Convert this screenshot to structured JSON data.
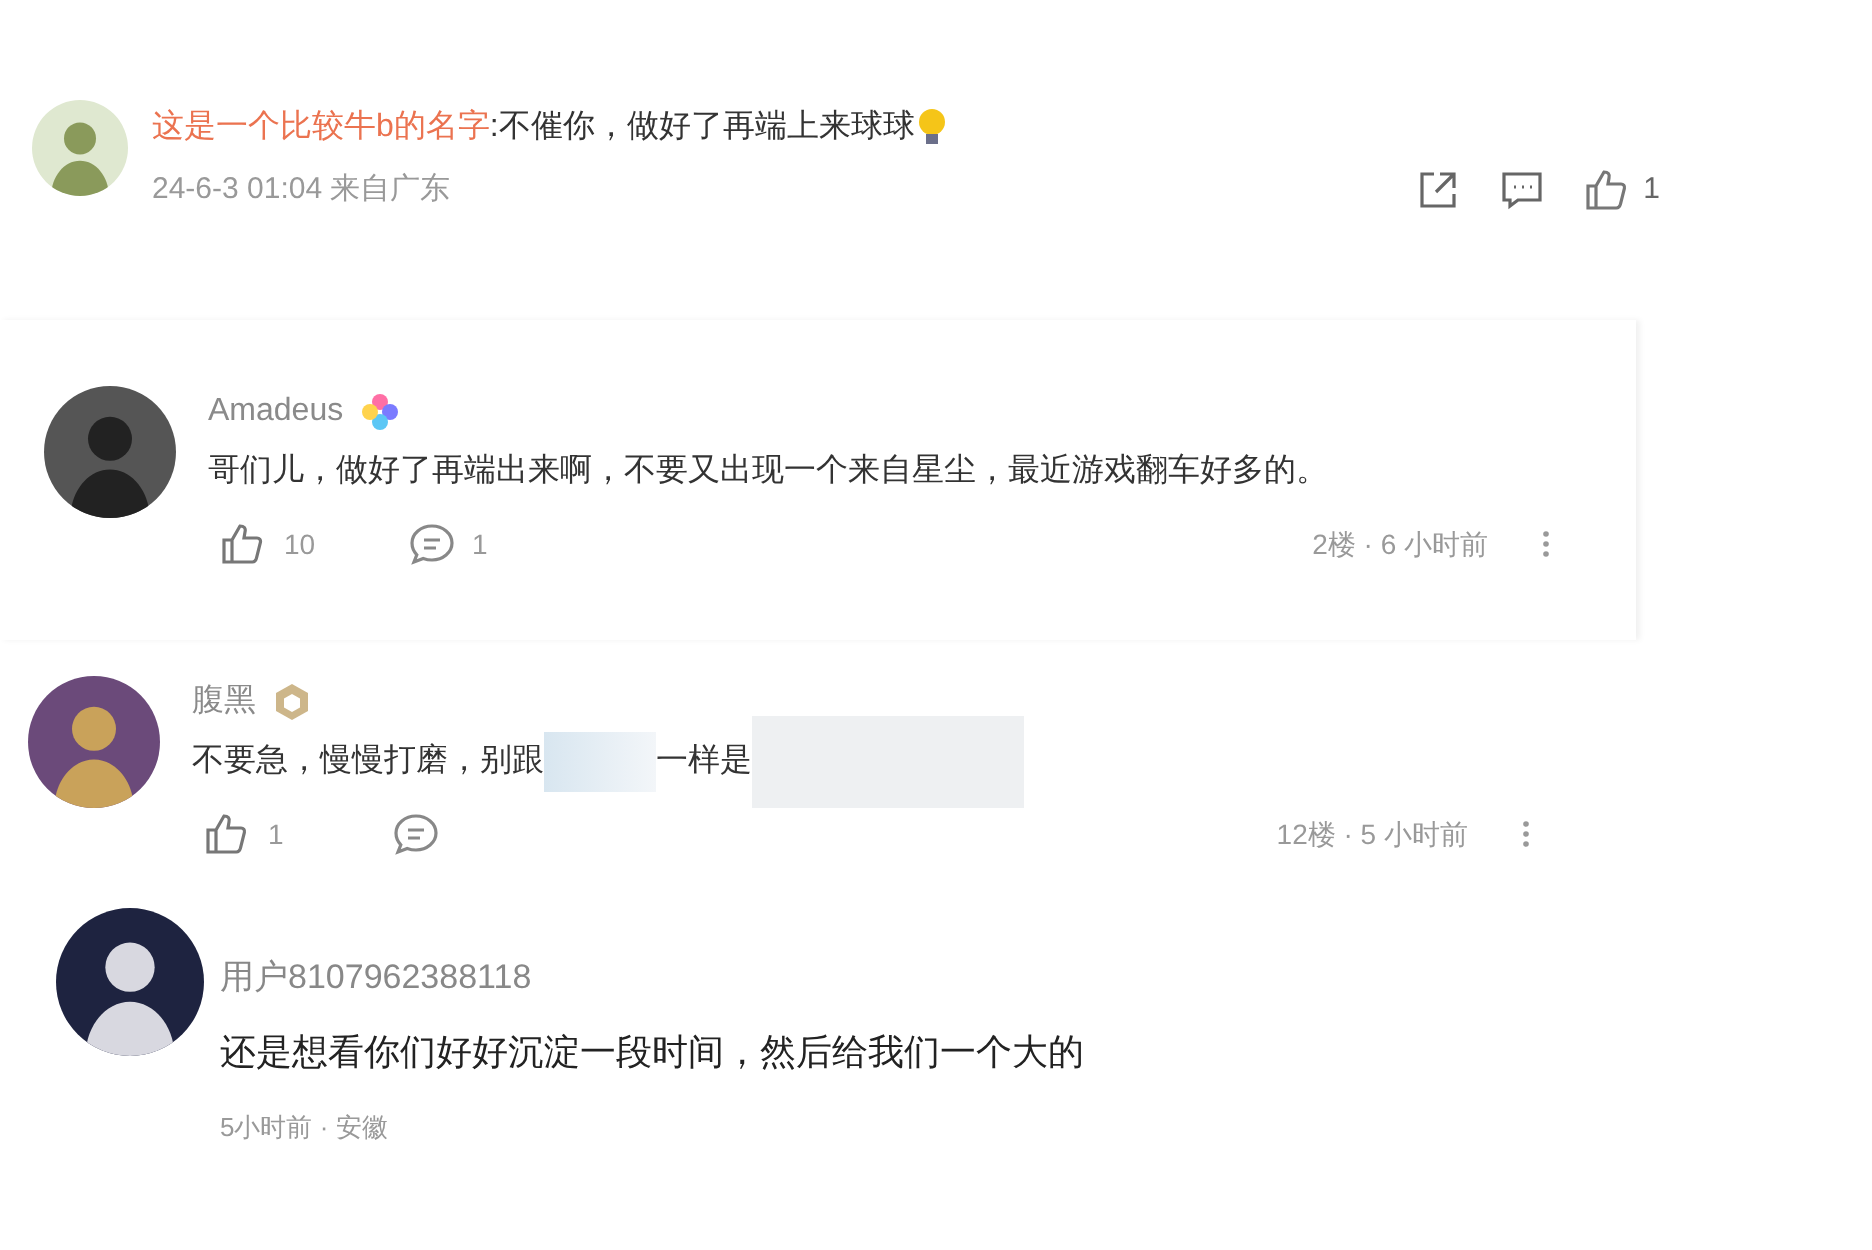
{
  "comments": [
    {
      "kind": "reply",
      "name": "这是一个比较牛b的名字",
      "separator": ":",
      "text": [
        {
          "kind": "text",
          "value": "不催你，做好了再端上来球球"
        },
        {
          "kind": "emoji"
        }
      ],
      "meta": "24-6-3 01:04 来自广东",
      "like_count": "1"
    },
    {
      "kind": "card",
      "name": "Amadeus",
      "badge": {
        "kind": "flower"
      },
      "text": [
        {
          "kind": "text",
          "value": "哥们儿，做好了再端出来啊，不要又出现一个来自星尘，最近游戏翻车好多的。"
        }
      ],
      "like_count": "10",
      "reply_count": "1",
      "meta": "2楼 · 6 小时前"
    },
    {
      "kind": "card",
      "name": "腹黑",
      "badge": {
        "kind": "hexagon"
      },
      "text": [
        {
          "kind": "text",
          "value": "不要急，慢慢打磨，别跟"
        },
        {
          "kind": "blur_small"
        },
        {
          "kind": "text",
          "value": "一样是"
        },
        {
          "kind": "blur_large"
        }
      ],
      "like_count": "1",
      "meta": "12楼 · 5 小时前"
    },
    {
      "kind": "plain",
      "name": "用户8107962388118",
      "text": [
        {
          "kind": "text",
          "value": "还是想看你们好好沉淀一段时间，然后给我们一个大的"
        }
      ],
      "meta": "5小时前 · 安徽"
    }
  ]
}
